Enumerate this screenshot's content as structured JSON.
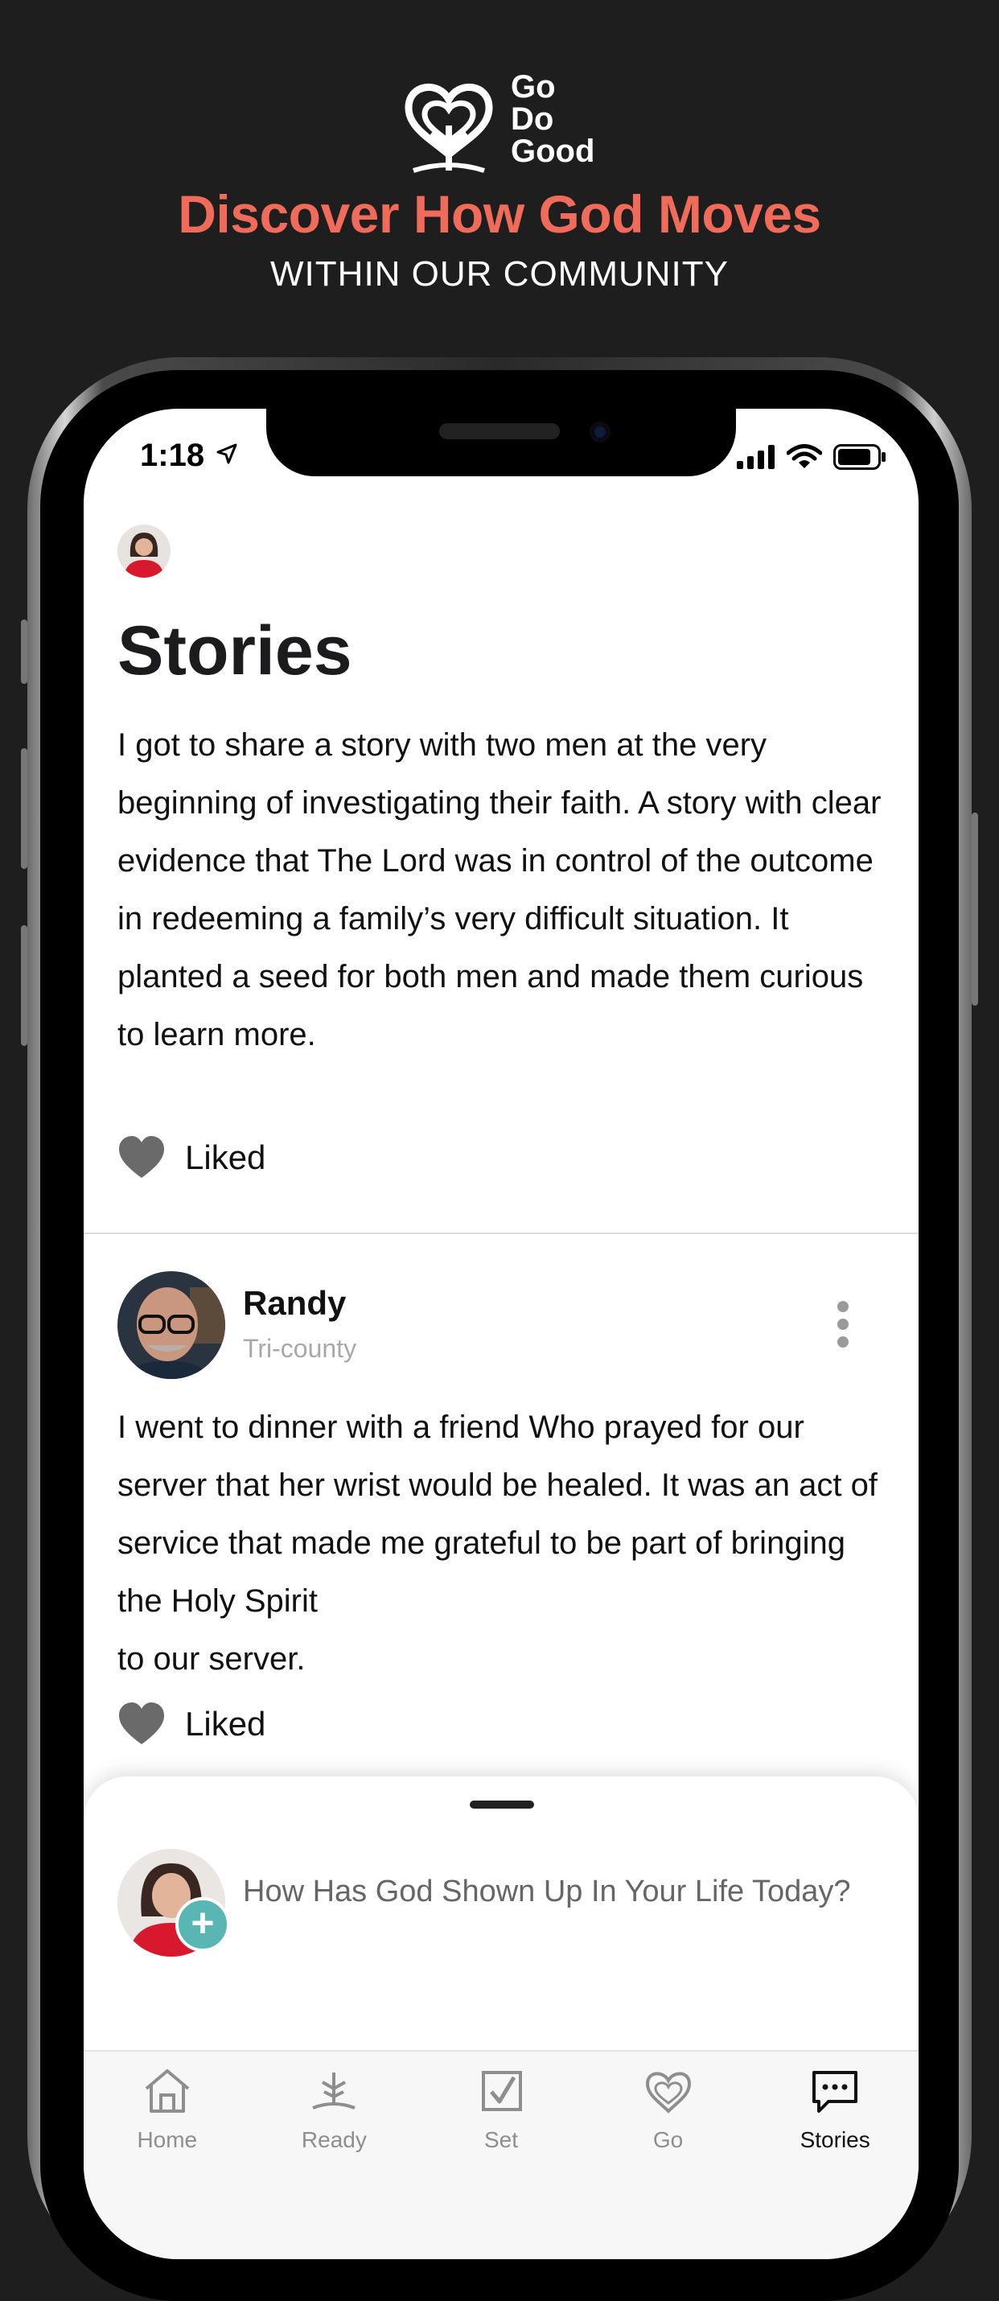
{
  "brand": {
    "word_lines": [
      "Go",
      "Do",
      "Good"
    ]
  },
  "promo": {
    "title": "Discover How God Moves",
    "subtitle": "WITHIN OUR COMMUNITY",
    "accent_color": "#f06b5a"
  },
  "status_bar": {
    "time": "1:18"
  },
  "header": {
    "title": "Stories"
  },
  "stories": [
    {
      "text": "I got to share a story with two men at the very beginning of investigating their faith.  A story with clear evidence that The Lord was in control of the outcome in redeeming a family’s very difficult situation.  It planted a seed for both men and made them curious to learn more.",
      "like_label": "Liked"
    },
    {
      "author": "Randy",
      "location": "Tri-county",
      "text": "I went to dinner with a friend Who prayed for our server that her wrist would be healed. It was an act of service that made me grateful to be part of bringing the Holy Spirit\n to our server.",
      "like_label": "Liked"
    }
  ],
  "composer": {
    "prompt": "How Has God Shown Up In Your Life Today?",
    "badge_icon": "plus-icon",
    "badge_color": "#58b7b3"
  },
  "tabs": [
    {
      "label": "Home",
      "icon": "home-icon"
    },
    {
      "label": "Ready",
      "icon": "sprout-icon"
    },
    {
      "label": "Set",
      "icon": "checkbox-icon"
    },
    {
      "label": "Go",
      "icon": "heart-icon"
    },
    {
      "label": "Stories",
      "icon": "chat-bubble-icon",
      "active": true
    }
  ]
}
